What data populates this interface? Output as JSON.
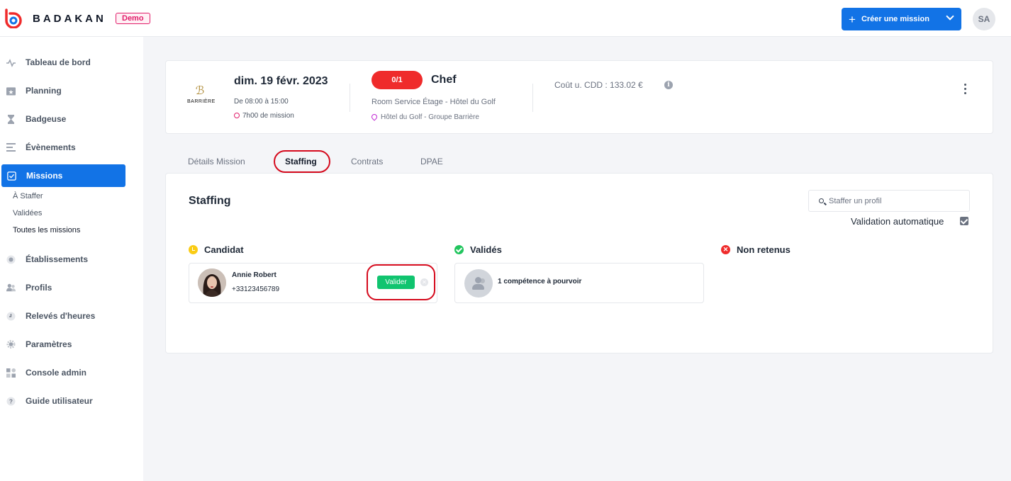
{
  "app": {
    "brand": "BADAKAN",
    "badge": "Demo",
    "create_button": "Créer une mission",
    "user_initials": "SA"
  },
  "sidebar": {
    "items": [
      {
        "label": "Tableau de bord",
        "icon": "pulse-icon"
      },
      {
        "label": "Planning",
        "icon": "calendar-star-icon"
      },
      {
        "label": "Badgeuse",
        "icon": "hourglass-icon"
      },
      {
        "label": "Évènements",
        "icon": "list-icon"
      },
      {
        "label": "Missions",
        "icon": "checklist-icon"
      },
      {
        "label": "Établissements",
        "icon": "building-icon"
      },
      {
        "label": "Profils",
        "icon": "users-icon"
      },
      {
        "label": "Relevés d'heures",
        "icon": "clock-icon"
      },
      {
        "label": "Paramètres",
        "icon": "gear-icon"
      },
      {
        "label": "Console admin",
        "icon": "grid-icon"
      },
      {
        "label": "Guide utilisateur",
        "icon": "question-icon"
      }
    ],
    "mission_subitems": [
      "À Staffer",
      "Validées",
      "Toutes les missions"
    ]
  },
  "mission": {
    "logo_text": "BARRIÈRE",
    "date": "dim. 19 févr. 2023",
    "hours": "De 08:00 à 15:00",
    "duration": "7h00 de mission",
    "staffing_badge": "0/1",
    "role": "Chef",
    "service": "Room Service Étage - Hôtel du Golf",
    "place": "Hôtel du Golf - Groupe Barrière",
    "cost": "Coût u. CDD : 133.02 €"
  },
  "tabs": [
    "Détails Mission",
    "Staffing",
    "Contrats",
    "DPAE"
  ],
  "staffing": {
    "title": "Staffing",
    "search_placeholder": "Staffer un profil",
    "auto_validation": "Validation automatique",
    "columns": {
      "candidat": "Candidat",
      "valides": "Validés",
      "non_retenus": "Non retenus"
    },
    "candidate": {
      "name": "Annie Robert",
      "phone": "+33123456789",
      "validate_label": "Valider"
    },
    "validated_placeholder": "1 compétence à pourvoir"
  },
  "colors": {
    "primary": "#1273e6",
    "badge_red": "#ef2b2b",
    "valider_green": "#10c46f",
    "highlight_ring": "#d50a1d"
  }
}
